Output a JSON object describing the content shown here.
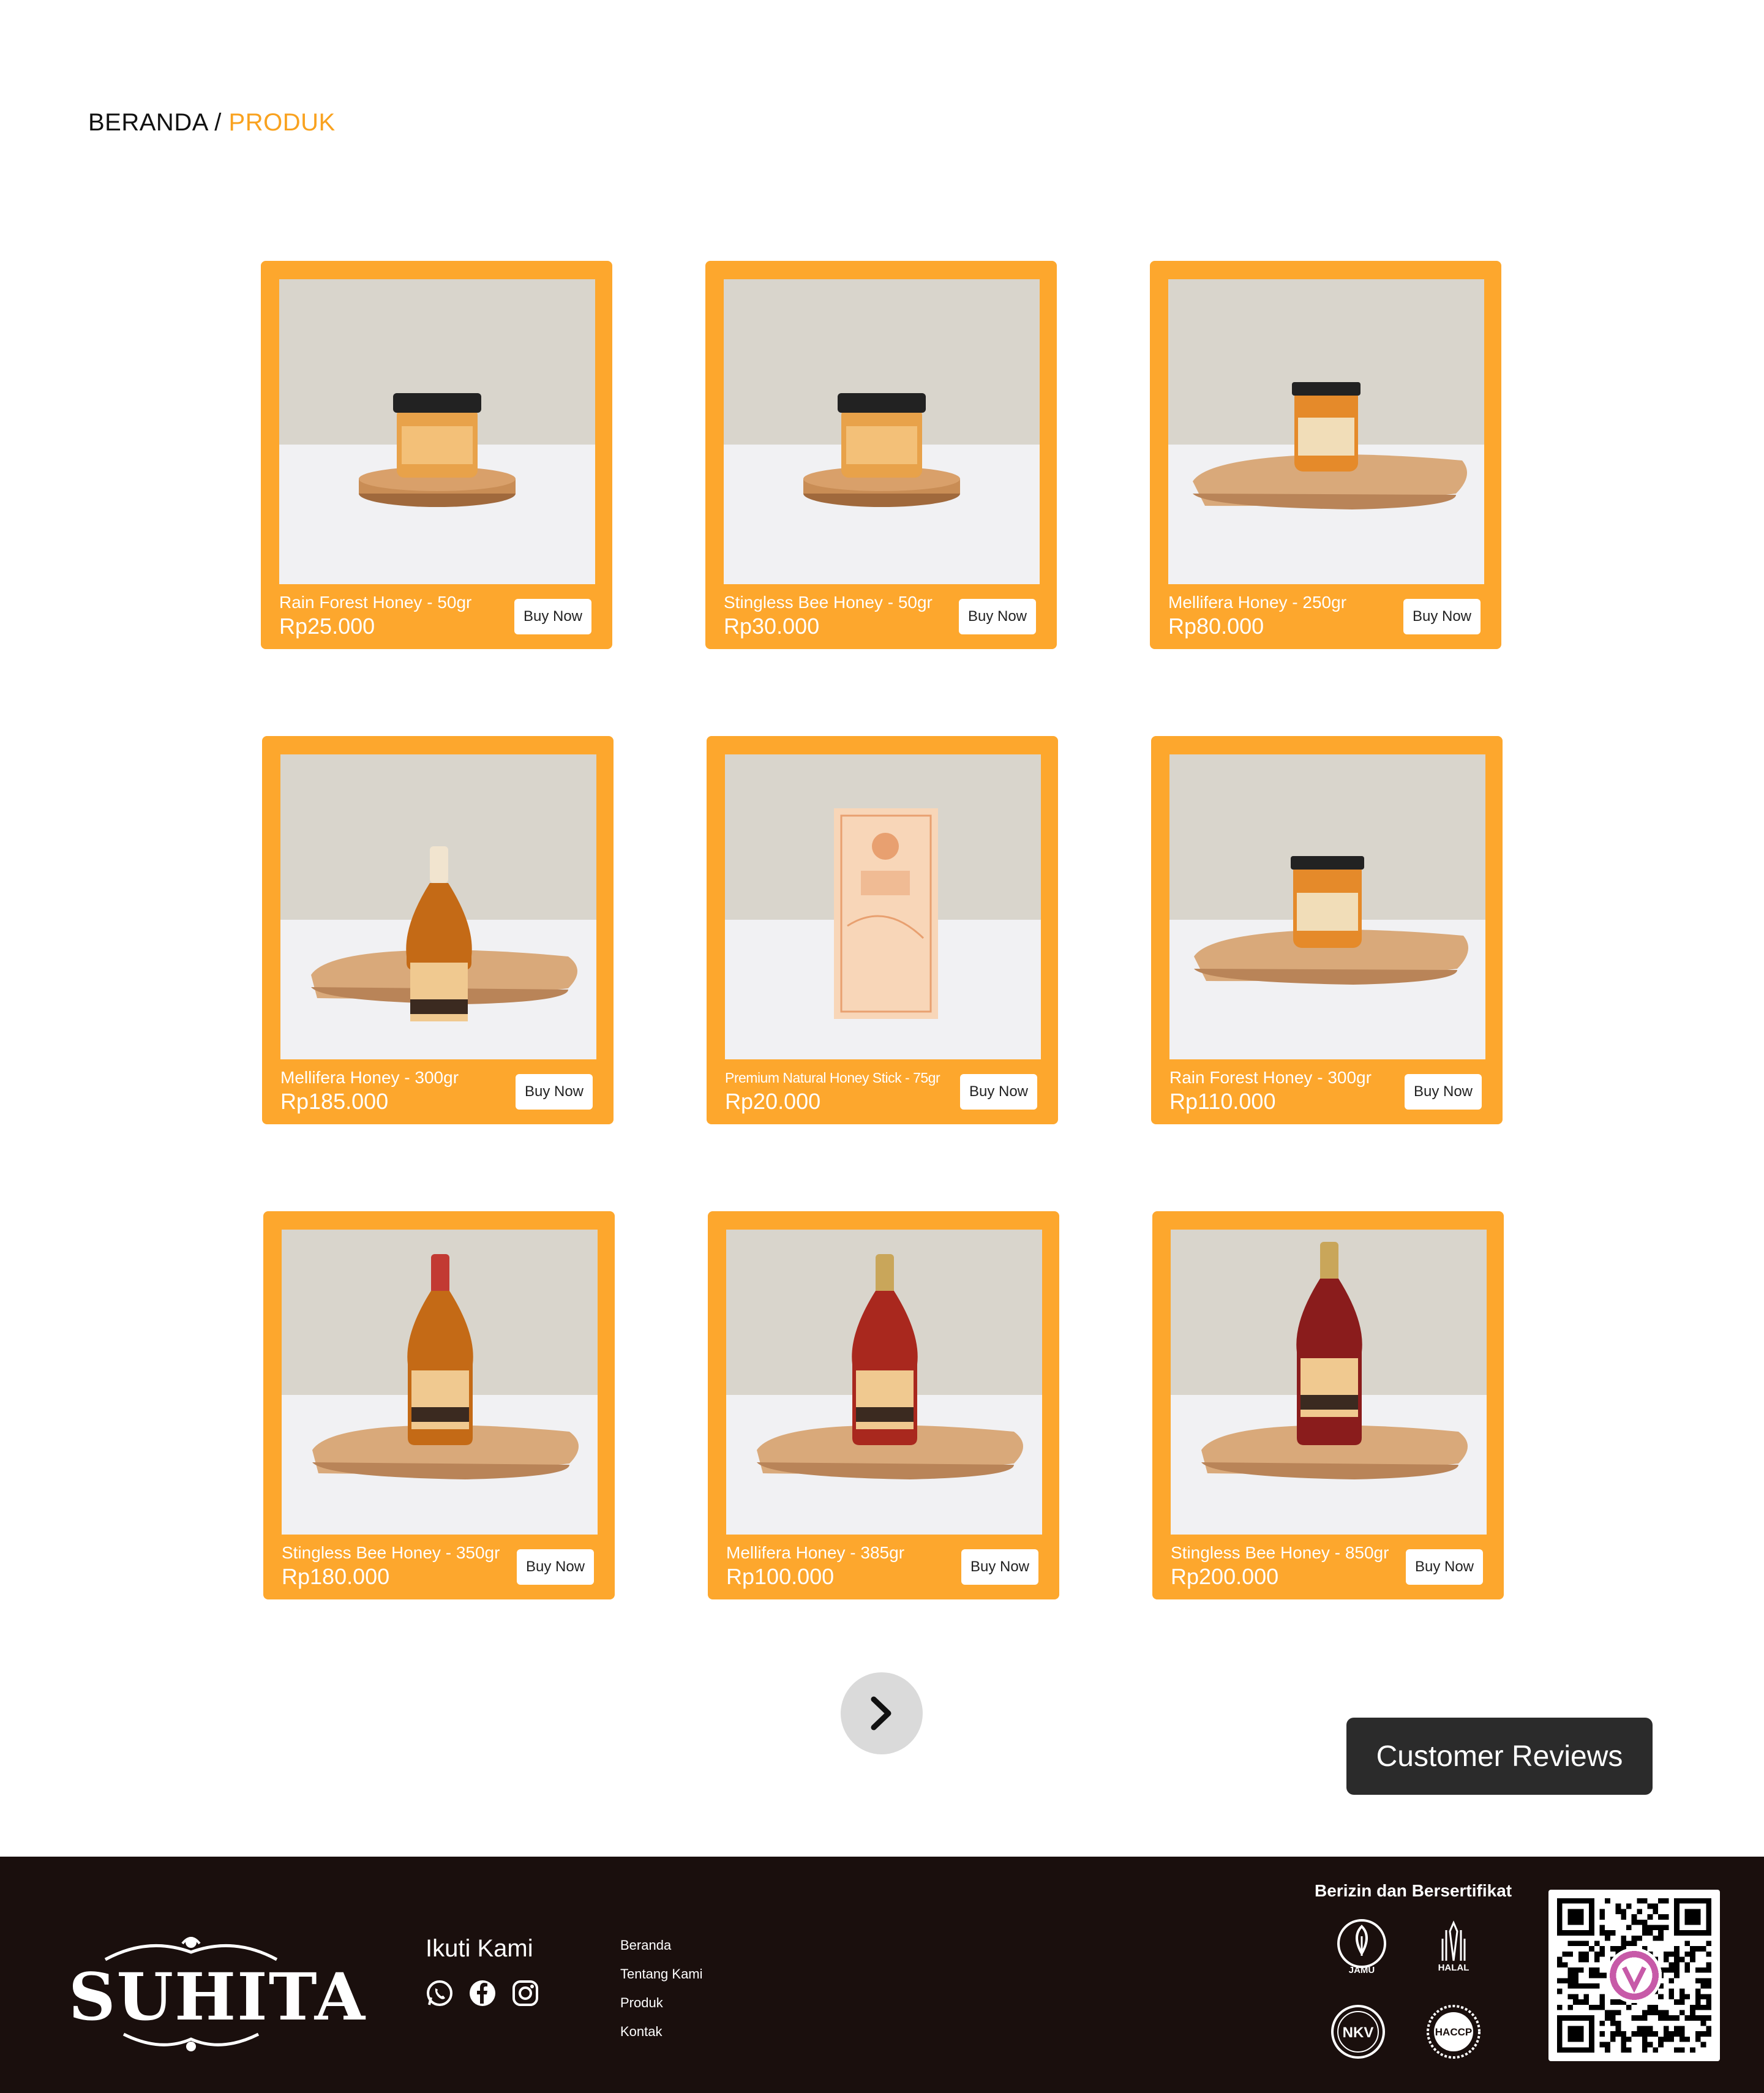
{
  "breadcrumb": {
    "home": "BERANDA",
    "separator": " / ",
    "current": "PRODUK",
    "current_color": "#f9a21f"
  },
  "accent_color": "#fda72d",
  "products": [
    {
      "name": "Rain Forest Honey - 50gr",
      "price": "Rp25.000",
      "button": "Buy Now",
      "item": "small-jar"
    },
    {
      "name": "Stingless Bee Honey - 50gr",
      "price": "Rp30.000",
      "button": "Buy Now",
      "item": "small-jar"
    },
    {
      "name": "Mellifera Honey - 250gr",
      "price": "Rp80.000",
      "button": "Buy Now",
      "item": "medium-jar"
    },
    {
      "name": "Mellifera Honey - 300gr",
      "price": "Rp185.000",
      "button": "Buy Now",
      "item": "small-bottle"
    },
    {
      "name": "Premium Natural Honey Stick - 75gr",
      "price": "Rp20.000",
      "button": "Buy Now",
      "item": "box"
    },
    {
      "name": "Rain Forest Honey - 300gr",
      "price": "Rp110.000",
      "button": "Buy Now",
      "item": "large-jar"
    },
    {
      "name": "Stingless Bee Honey - 350gr",
      "price": "Rp180.000",
      "button": "Buy Now",
      "item": "red-cap-bottle"
    },
    {
      "name": "Mellifera Honey - 385gr",
      "price": "Rp100.000",
      "button": "Buy Now",
      "item": "gold-cap-bottle"
    },
    {
      "name": "Stingless Bee Honey - 850gr",
      "price": "Rp200.000",
      "button": "Buy Now",
      "item": "tall-bottle"
    }
  ],
  "pagination": {
    "next_icon": "chevron-right-icon"
  },
  "reviews_button": "Customer Reviews",
  "footer": {
    "brand": "SUHITA",
    "follow_title": "Ikuti Kami",
    "social_icons": [
      "whatsapp-icon",
      "facebook-icon",
      "instagram-icon"
    ],
    "nav": [
      "Beranda",
      "Tentang Kami",
      "Produk",
      "Kontak"
    ],
    "cert_title": "Berizin dan Bersertifikat",
    "badges": [
      "JAMU",
      "HALAL",
      "NKV",
      "HACCP"
    ]
  }
}
